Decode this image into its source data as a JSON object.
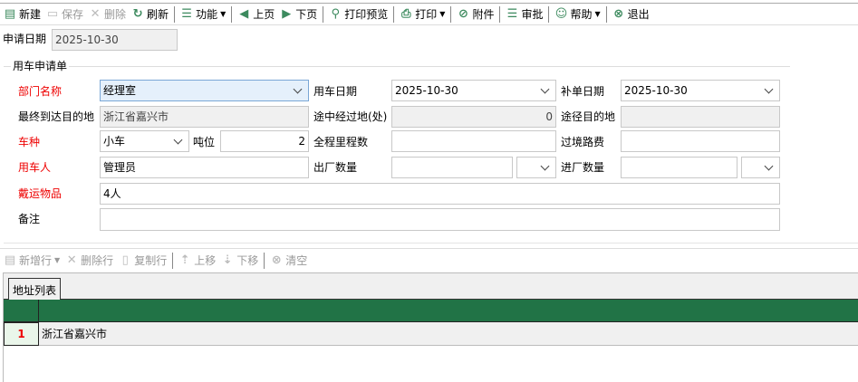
{
  "toolbar": {
    "items": [
      {
        "label": "新建",
        "icon": "new-doc-icon",
        "enabled": true
      },
      {
        "label": "保存",
        "icon": "save-icon",
        "enabled": false
      },
      {
        "label": "删除",
        "icon": "delete-icon",
        "enabled": false
      },
      {
        "label": "刷新",
        "icon": "refresh-icon",
        "enabled": true
      },
      {
        "label": "功能",
        "icon": "list-icon",
        "enabled": true
      },
      {
        "label": "上页",
        "icon": "prev-icon",
        "enabled": true
      },
      {
        "label": "下页",
        "icon": "next-icon",
        "enabled": true
      },
      {
        "label": "打印预览",
        "icon": "print-preview-icon",
        "enabled": true
      },
      {
        "label": "打印",
        "icon": "print-icon",
        "enabled": true
      },
      {
        "label": "附件",
        "icon": "attachment-icon",
        "enabled": true
      },
      {
        "label": "审批",
        "icon": "approve-icon",
        "enabled": true
      },
      {
        "label": "帮助",
        "icon": "help-icon",
        "enabled": true
      },
      {
        "label": "退出",
        "icon": "exit-icon",
        "enabled": true
      }
    ]
  },
  "apply_date": {
    "label": "申请日期",
    "value": "2025-10-30"
  },
  "form": {
    "title": "用车申请单",
    "dept": {
      "label": "部门名称",
      "value": "经理室"
    },
    "use_date": {
      "label": "用车日期",
      "value": "2025-10-30"
    },
    "supp_date": {
      "label": "补单日期",
      "value": "2025-10-30"
    },
    "dest": {
      "label": "最终到达目的地",
      "value": "浙江省嘉兴市"
    },
    "via_count": {
      "label": "途中经过地(处)",
      "value": "0"
    },
    "via_dest": {
      "label": "途径目的地",
      "value": ""
    },
    "car_type": {
      "label": "车种",
      "value": "小车"
    },
    "tonnage": {
      "label": "吨位",
      "value": "2"
    },
    "mileage": {
      "label": "全程里程数",
      "value": ""
    },
    "toll": {
      "label": "过境路费",
      "value": ""
    },
    "user": {
      "label": "用车人",
      "value": "管理员"
    },
    "out_qty": {
      "label": "出厂数量",
      "value": ""
    },
    "in_qty": {
      "label": "进厂数量",
      "value": ""
    },
    "cargo": {
      "label": "戴运物品",
      "value": "4人"
    },
    "remark": {
      "label": "备注",
      "value": ""
    }
  },
  "grid_toolbar": {
    "add": "新增行",
    "del": "删除行",
    "copy": "复制行",
    "up": "上移",
    "down": "下移",
    "clear": "清空"
  },
  "tab": {
    "label": "地址列表"
  },
  "grid": {
    "header_color": "#217346",
    "rows": [
      {
        "no": "1",
        "address": "浙江省嘉兴市"
      }
    ]
  }
}
